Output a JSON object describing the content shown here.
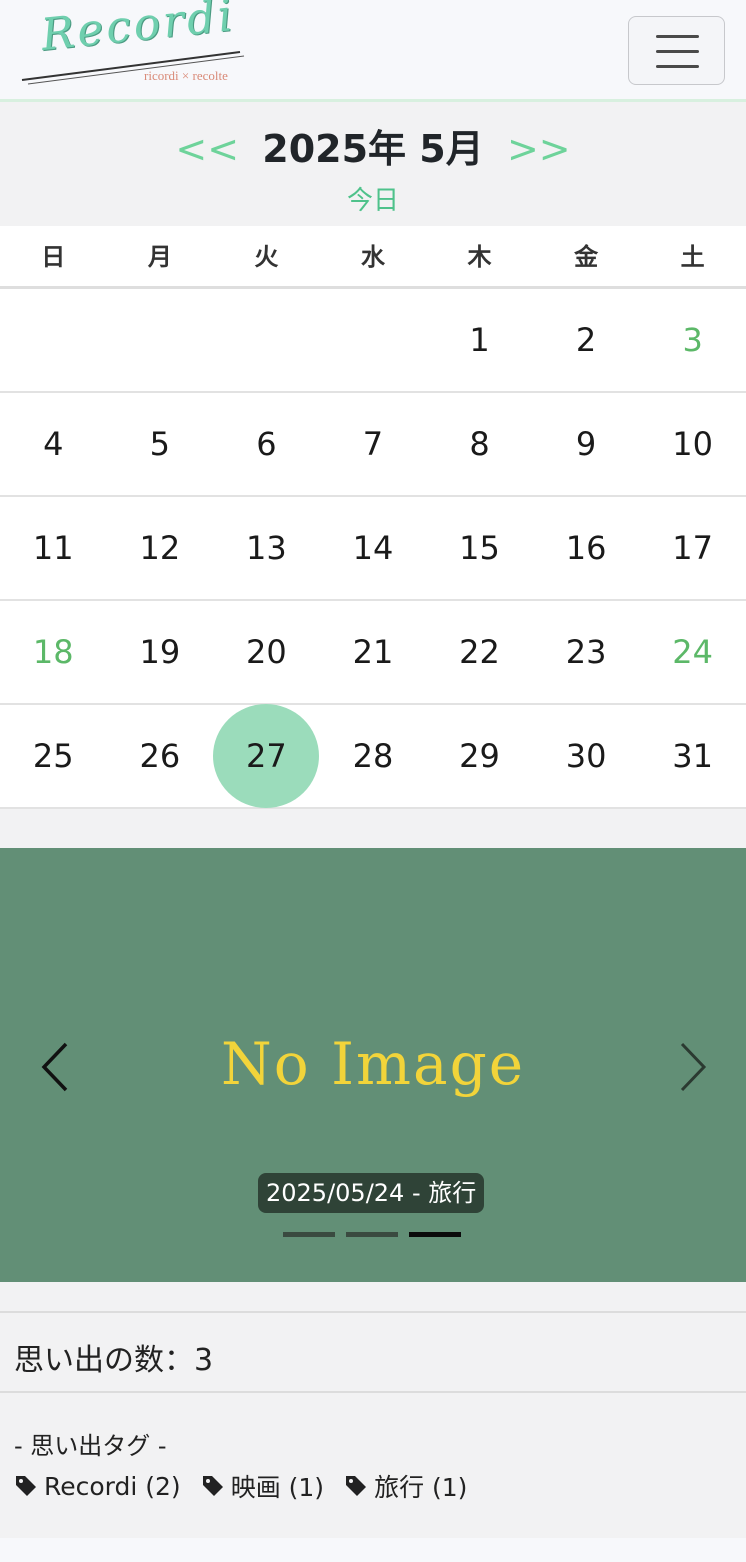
{
  "brand": {
    "title": "Recordi",
    "subtitle": "ricordi × recolte"
  },
  "calendar": {
    "prev_label": "<<",
    "next_label": ">>",
    "title": "2025年 5月",
    "today_label": "今日",
    "weekdays": [
      "日",
      "月",
      "火",
      "水",
      "木",
      "金",
      "土"
    ],
    "weeks": [
      [
        "",
        "",
        "",
        "",
        "1",
        "2",
        "3"
      ],
      [
        "4",
        "5",
        "6",
        "7",
        "8",
        "9",
        "10"
      ],
      [
        "11",
        "12",
        "13",
        "14",
        "15",
        "16",
        "17"
      ],
      [
        "18",
        "19",
        "20",
        "21",
        "22",
        "23",
        "24"
      ],
      [
        "25",
        "26",
        "27",
        "28",
        "29",
        "30",
        "31"
      ]
    ],
    "memory_days": [
      "3",
      "18",
      "24"
    ],
    "today": "27"
  },
  "carousel": {
    "placeholder": "No Image",
    "caption": "2025/05/24 - 旅行",
    "slide_count": 3,
    "active_slide": 3
  },
  "summary": {
    "count_label": "思い出の数：3"
  },
  "tags": {
    "title": "- 思い出タグ -",
    "items": [
      {
        "label": "Recordi (2)"
      },
      {
        "label": "映画 (1)"
      },
      {
        "label": "旅行 (1)"
      }
    ]
  },
  "colors": {
    "accent": "#6ed39a",
    "memory_day": "#5cb868",
    "today_circle": "#9bdcbb",
    "carousel_bg": "#628f76",
    "placeholder_text": "#f2d43a"
  }
}
